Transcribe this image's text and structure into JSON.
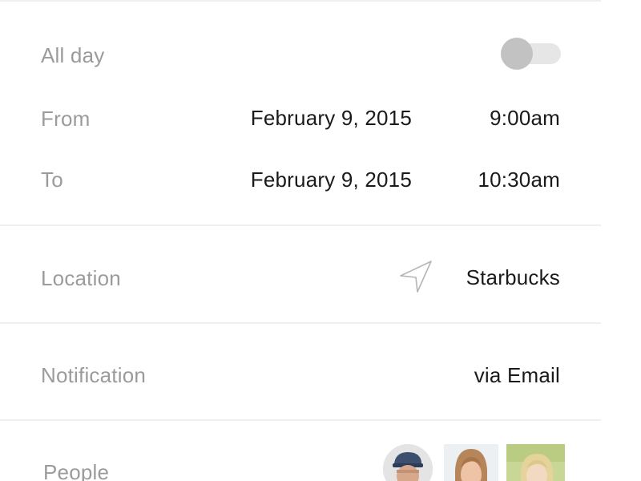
{
  "all_day": {
    "label": "All day",
    "toggle_on": false
  },
  "from": {
    "label": "From",
    "date": "February 9, 2015",
    "time": "9:00am"
  },
  "to": {
    "label": "To",
    "date": "February 9, 2015",
    "time": "10:30am"
  },
  "location": {
    "label": "Location",
    "icon": "location-arrow-icon",
    "value": "Starbucks"
  },
  "notification": {
    "label": "Notification",
    "value": "via Email"
  },
  "people": {
    "label": "People",
    "avatars": [
      "avatar-man",
      "avatar-woman",
      "avatar-girl"
    ]
  },
  "colors": {
    "label": "#9b9b9b",
    "value": "#1a1a1a",
    "divider": "#efefef",
    "toggle_knob": "#c2c2c2",
    "toggle_track": "#e6e6e6"
  }
}
